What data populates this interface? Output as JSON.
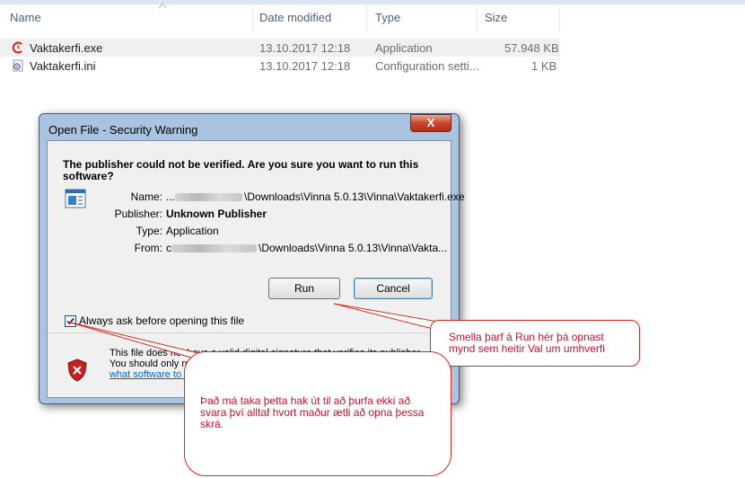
{
  "columns": {
    "name": "Name",
    "date_modified": "Date modified",
    "type": "Type",
    "size": "Size"
  },
  "files": [
    {
      "name": "Vaktakerfi.exe",
      "date": "13.10.2017 12:18",
      "type": "Application",
      "size": "57.948 KB",
      "icon": "app-clock-icon",
      "selected": true
    },
    {
      "name": "Vaktakerfi.ini",
      "date": "13.10.2017 12:18",
      "type": "Configuration setti...",
      "size": "1 KB",
      "icon": "config-file-icon",
      "selected": false
    }
  ],
  "dialog": {
    "title": "Open File - Security Warning",
    "close_label": "X",
    "headline": "The publisher could not be verified.  Are you sure you want to run this software?",
    "fields": {
      "name_label": "Name:",
      "name_value": "\\Downloads\\Vinna 5.0.13\\Vinna\\Vaktakerfi.exe",
      "name_prefix": "...",
      "publisher_label": "Publisher:",
      "publisher_value": "Unknown Publisher",
      "type_label": "Type:",
      "type_value": "Application",
      "from_label": "From:",
      "from_prefix": "c",
      "from_value": "\\Downloads\\Vinna 5.0.13\\Vinna\\Vakta..."
    },
    "run_label": "Run",
    "cancel_label": "Cancel",
    "checkbox_label": "Always ask before opening this file",
    "checkbox_checked": true,
    "warning_line1": "This file does not have a valid digital signature that verifies its publisher.",
    "warning_line2": "You should only run software from publishers you trust.",
    "warning_link": "How can I decide what software to run?"
  },
  "callouts": {
    "run_note": "Smella þarf á Run hér þá opnast mynd  sem heitir Val um umhverfi",
    "checkbox_note": "Það má taka þetta hak út til að þurfa ekki að svara því alltaf hvort maður ætli að opna þessa skrá."
  },
  "colors": {
    "callout_border": "#d9281e",
    "callout_text": "#c8102e",
    "dialog_frame": "#a9c3e0"
  }
}
